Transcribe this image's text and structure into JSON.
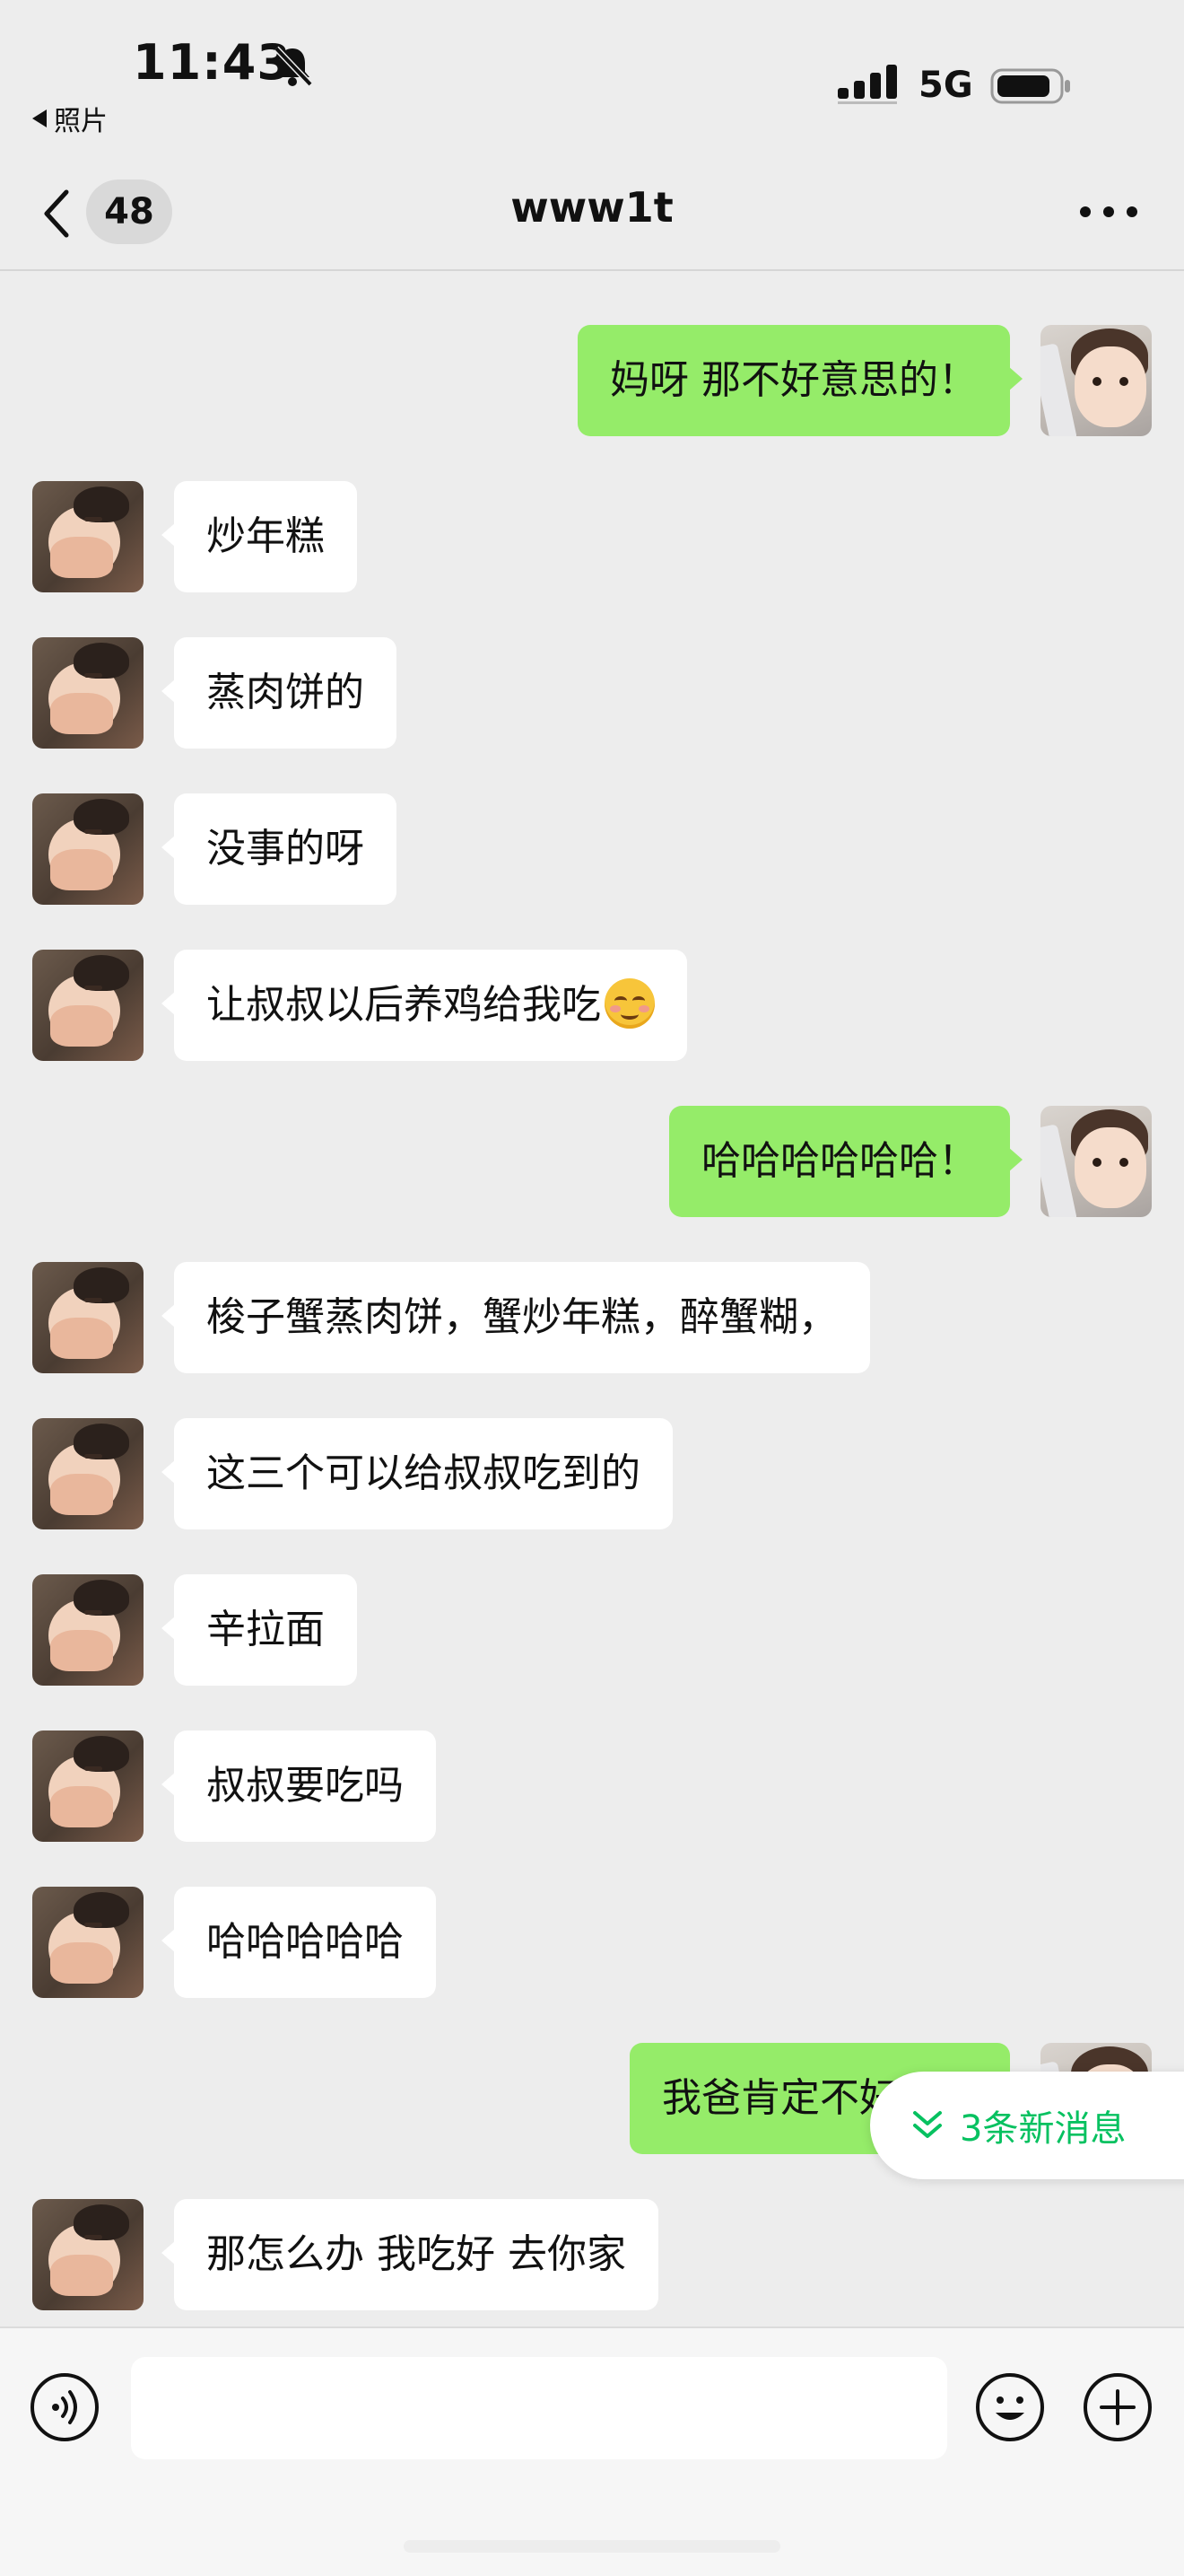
{
  "status_bar": {
    "time": "11:43",
    "back_app_label": "照片",
    "network": "5G",
    "icons": [
      "bell-muted-icon",
      "signal-icon",
      "battery-icon"
    ]
  },
  "header": {
    "back_icon": "chevron-left-icon",
    "unread_count": "48",
    "title": "www1t",
    "more_icon": "more-dots-icon"
  },
  "messages": [
    {
      "side": "right",
      "text": "妈呀 那不好意思的！"
    },
    {
      "side": "left",
      "text": "炒年糕"
    },
    {
      "side": "left",
      "text": "蒸肉饼的"
    },
    {
      "side": "left",
      "text": "没事的呀"
    },
    {
      "side": "left",
      "text": "让叔叔以后养鸡给我吃",
      "emoji": "blushing-smile-emoji"
    },
    {
      "side": "right",
      "text": "哈哈哈哈哈哈！"
    },
    {
      "side": "left",
      "text": "梭子蟹蒸肉饼，蟹炒年糕，醉蟹糊，"
    },
    {
      "side": "left",
      "text": "这三个可以给叔叔吃到的"
    },
    {
      "side": "left",
      "text": "辛拉面"
    },
    {
      "side": "left",
      "text": "叔叔要吃吗"
    },
    {
      "side": "left",
      "text": "哈哈哈哈哈"
    },
    {
      "side": "right",
      "text": "我爸肯定不好意思"
    },
    {
      "side": "left",
      "text": "那怎么办 我吃好 去你家"
    }
  ],
  "new_messages_pill": {
    "label": "3条新消息",
    "icon": "double-chevron-down-icon",
    "accent": "#07c160"
  },
  "input_bar": {
    "voice_icon": "voice-icon",
    "emoji_icon": "emoji-icon",
    "plus_icon": "plus-circle-icon",
    "placeholder": ""
  },
  "colors": {
    "background": "#ededed",
    "outgoing_bubble": "#95ec69",
    "incoming_bubble": "#ffffff"
  }
}
